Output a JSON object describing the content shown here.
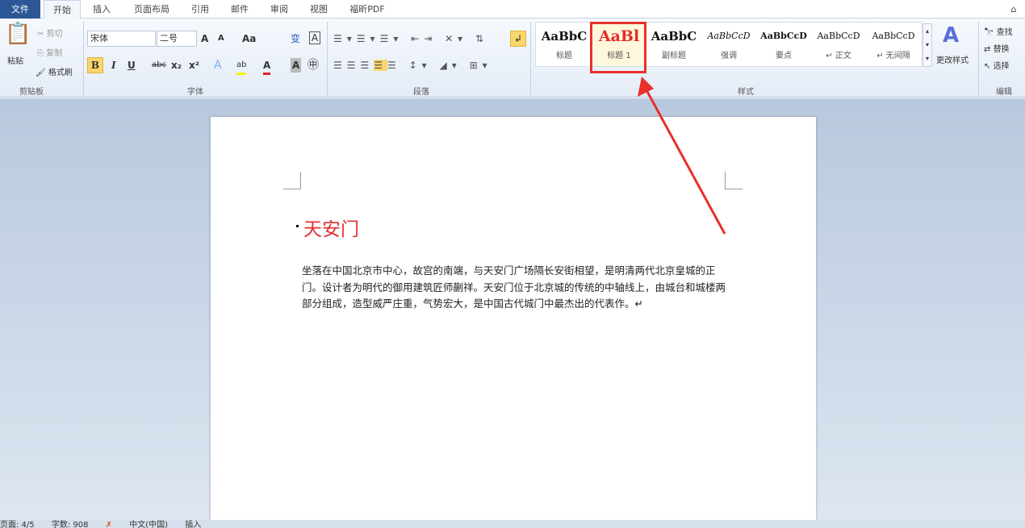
{
  "tabs": [
    "文件",
    "开始",
    "插入",
    "页面布局",
    "引用",
    "邮件",
    "审阅",
    "视图",
    "福昕PDF"
  ],
  "clipboard": {
    "paste": "粘贴",
    "cut": "剪切",
    "copy": "复制",
    "format_painter": "格式刷",
    "label": "剪贴板"
  },
  "font": {
    "name": "宋体",
    "size": "二号",
    "label": "字体",
    "grow": "A",
    "shrink": "A",
    "case": "Aa",
    "bold": "B",
    "italic": "I",
    "underline": "U",
    "strike": "abc",
    "sub": "x₂",
    "sup": "x²",
    "text_effect": "A",
    "highlight": "ab",
    "color": "A",
    "shade": "A",
    "enclose": "㊥",
    "phonetic": "变",
    "border": "A"
  },
  "paragraph": {
    "label": "段落"
  },
  "styles": {
    "label": "样式",
    "items": [
      {
        "preview": "AaBbC",
        "name": "标题"
      },
      {
        "preview": "AaBl",
        "name": "标题 1"
      },
      {
        "preview": "AaBbC",
        "name": "副标题"
      },
      {
        "preview": "AaBbCcD",
        "name": "强调"
      },
      {
        "preview": "AaBbCcD",
        "name": "要点"
      },
      {
        "preview": "AaBbCcD",
        "name": "↵ 正文"
      },
      {
        "preview": "AaBbCcD",
        "name": "↵ 无间隔"
      }
    ],
    "change": "更改样式"
  },
  "editing": {
    "label": "编辑",
    "find": "查找",
    "replace": "替换",
    "select": "选择"
  },
  "document": {
    "heading": "天安门",
    "body": "坐落在中国北京市中心，故宫的南端，与天安门广场隔长安街相望，是明清两代北京皇城的正门。设计者为明代的御用建筑匠师蒯祥。天安门位于北京城的传统的中轴线上，由城台和城楼两部分组成，造型威严庄重，气势宏大，是中国古代城门中最杰出的代表作。↵"
  },
  "status": {
    "page": "页面: 4/5",
    "words": "字数: 908",
    "lang": "中文(中国)",
    "mode": "插入"
  },
  "colors": {
    "accent": "#e8302a",
    "file_tab": "#2b5797"
  }
}
